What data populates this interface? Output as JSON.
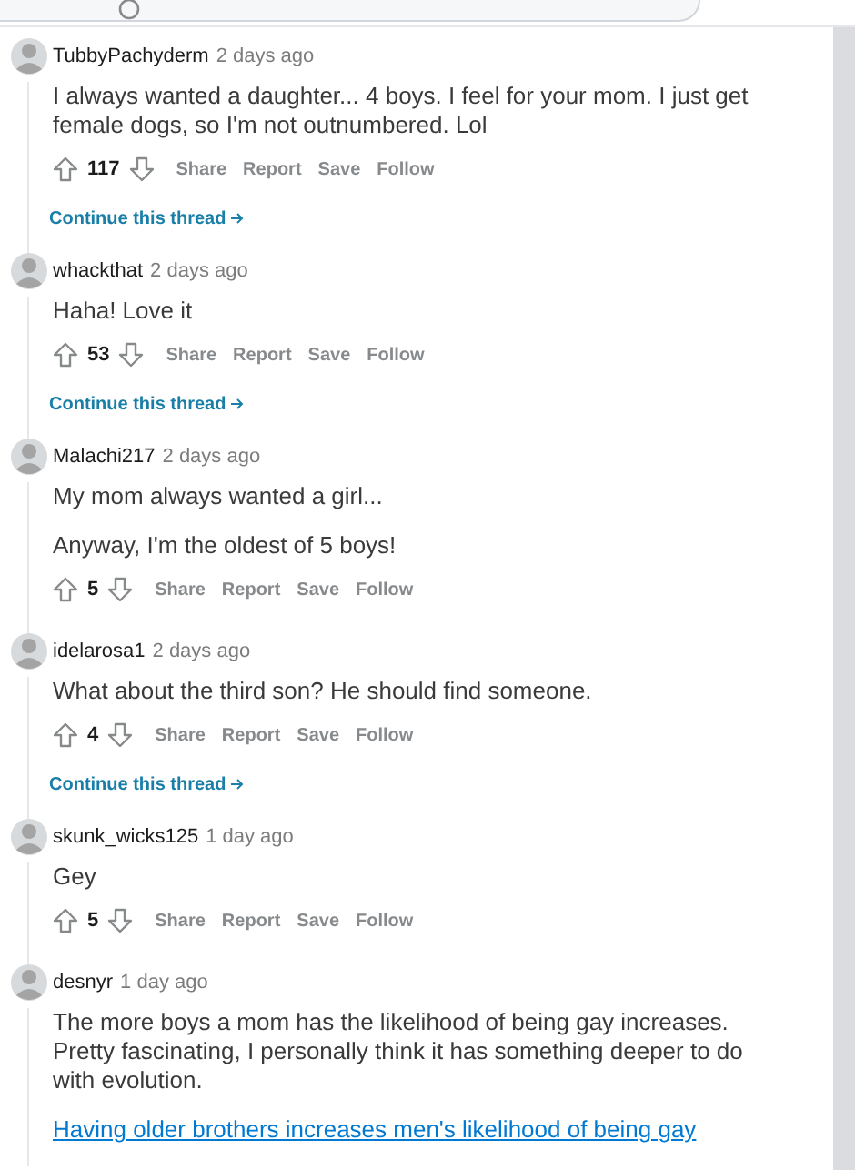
{
  "comments": [
    {
      "username": "TubbyPachyderm",
      "time": "2 days ago",
      "paragraphs": [
        "I always wanted a daughter... 4 boys. I feel for your mom. I just get female dogs, so I'm not outnumbered. Lol"
      ],
      "votes": "117",
      "actions": [
        "Share",
        "Report",
        "Save",
        "Follow"
      ],
      "continue_thread": "Continue this thread"
    },
    {
      "username": "whackthat",
      "time": "2 days ago",
      "paragraphs": [
        "Haha! Love it"
      ],
      "votes": "53",
      "actions": [
        "Share",
        "Report",
        "Save",
        "Follow"
      ],
      "continue_thread": "Continue this thread"
    },
    {
      "username": "Malachi217",
      "time": "2 days ago",
      "paragraphs": [
        "My mom always wanted a girl...",
        "Anyway, I'm the oldest of 5 boys!"
      ],
      "votes": "5",
      "actions": [
        "Share",
        "Report",
        "Save",
        "Follow"
      ]
    },
    {
      "username": "idelarosa1",
      "time": "2 days ago",
      "paragraphs": [
        "What about the third son? He should find someone."
      ],
      "votes": "4",
      "actions": [
        "Share",
        "Report",
        "Save",
        "Follow"
      ],
      "continue_thread": "Continue this thread"
    },
    {
      "username": "skunk_wicks125",
      "time": "1 day ago",
      "paragraphs": [
        "Gey"
      ],
      "votes": "5",
      "actions": [
        "Share",
        "Report",
        "Save",
        "Follow"
      ]
    },
    {
      "username": "desnyr",
      "time": "1 day ago",
      "paragraphs": [
        "The more boys a mom has the likelihood of being gay increases. Pretty fascinating, I personally think it has something deeper to do with evolution."
      ],
      "link": "Having older brothers increases men's likelihood of being gay"
    }
  ]
}
